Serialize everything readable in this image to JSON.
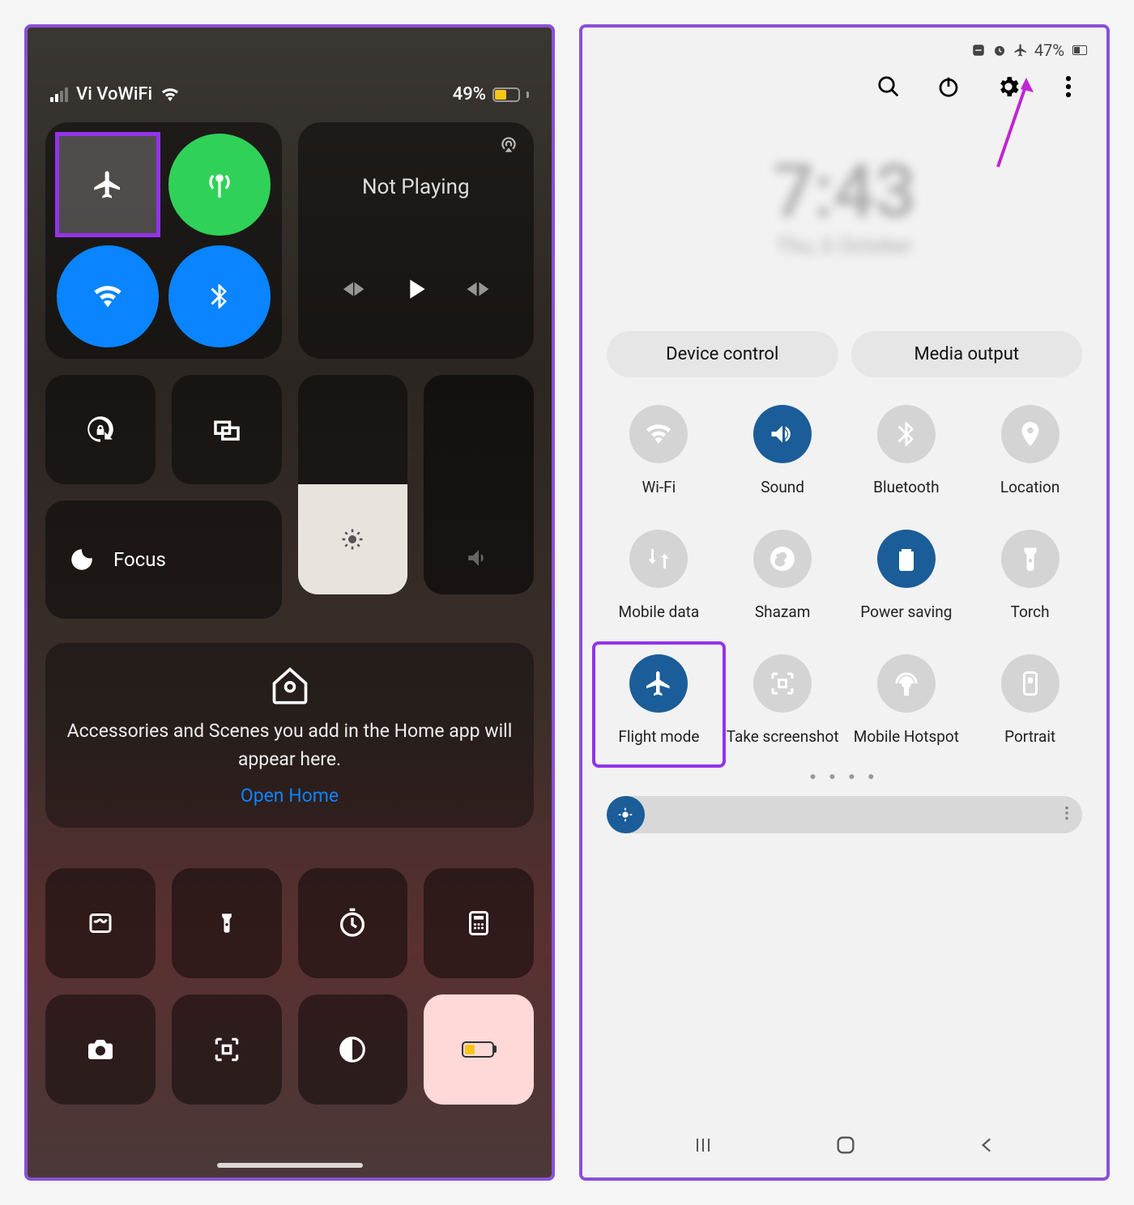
{
  "ios": {
    "status": {
      "carrier": "Vi VoWiFi",
      "battery_pct": "49%"
    },
    "media": {
      "title": "Not Playing"
    },
    "focus": {
      "label": "Focus"
    },
    "home": {
      "message": "Accessories and Scenes you add in the Home app will appear here.",
      "link": "Open Home"
    }
  },
  "android": {
    "status": {
      "battery_pct": "47%"
    },
    "clock": {
      "time": "7:43",
      "date": "Thu, 6 October"
    },
    "pills": {
      "device_control": "Device control",
      "media_output": "Media output"
    },
    "quick_settings": [
      {
        "label": "Wi-Fi",
        "icon": "wifi",
        "active": false
      },
      {
        "label": "Sound",
        "icon": "sound",
        "active": true
      },
      {
        "label": "Bluetooth",
        "icon": "bluetooth",
        "active": false
      },
      {
        "label": "Location",
        "icon": "location",
        "active": false
      },
      {
        "label": "Mobile data",
        "icon": "mobiledata",
        "active": false
      },
      {
        "label": "Shazam",
        "icon": "shazam",
        "active": false
      },
      {
        "label": "Power saving",
        "icon": "powersaving",
        "active": true
      },
      {
        "label": "Torch",
        "icon": "torch",
        "active": false
      },
      {
        "label": "Flight mode",
        "icon": "flight",
        "active": true,
        "highlight": true
      },
      {
        "label": "Take screenshot",
        "icon": "screenshot",
        "active": false
      },
      {
        "label": "Mobile Hotspot",
        "icon": "hotspot",
        "active": false
      },
      {
        "label": "Portrait",
        "icon": "portrait",
        "active": false
      }
    ]
  },
  "colors": {
    "highlight": "#9333ea",
    "ios_blue": "#0a84ff",
    "ios_green": "#30d158",
    "android_active": "#1b5d98"
  }
}
